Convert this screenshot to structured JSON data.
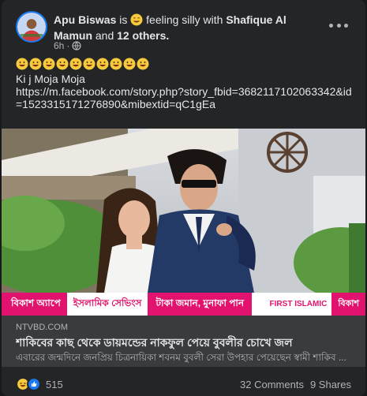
{
  "post": {
    "author": "Apu Biswas",
    "is_text": "is",
    "feeling_text": "feeling silly with",
    "tagged_person": "Shafique Al Mamun",
    "and_text": "and",
    "others_text": "12 others.",
    "time": "6h",
    "time_separator": "·",
    "emoji_count": 10,
    "text_line": "Ki j Moja Moja",
    "link_text": "https://m.facebook.com/story.php?story_fbid=3682117102063342&id=1523315171276890&mibextid=qC1gEa"
  },
  "banner": {
    "left": "বিকাশ অ্যাপে",
    "middle": "ইসলামিক সেভিংস",
    "right": "টাকা জমান, মুনাফা পান",
    "logo": "FIRST ISLAMIC",
    "brand": "বিকাশ"
  },
  "preview": {
    "domain": "NTVBD.COM",
    "title": "শাকিবের কাছ থেকে ডায়মন্ডের নাকফুল পেয়ে বুবলীর চোখে জল",
    "description": "এবারের জন্মদিনে জনপ্রিয় চিত্রনায়িকা শবনম বুবলী সেরা উপহার পেয়েছেন স্বামী শাকিব ..."
  },
  "footer": {
    "reaction_count": "515",
    "comments": "32 Comments",
    "shares": "9 Shares"
  },
  "colors": {
    "card_bg": "#242526",
    "text_primary": "#e4e6eb",
    "text_secondary": "#b0b3b8",
    "bkash_pink": "#e2136e",
    "like_blue": "#1877f2"
  },
  "icons": {
    "more": "more-horizontal-icon",
    "privacy": "globe-icon",
    "feeling": "silly-emoji-icon",
    "reactions": [
      "haha-reaction-icon",
      "like-reaction-icon"
    ]
  }
}
